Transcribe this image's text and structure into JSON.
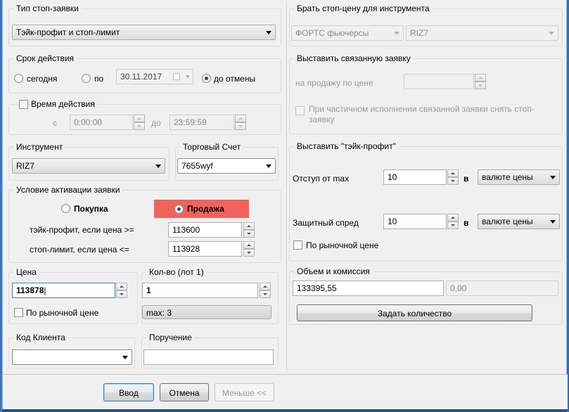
{
  "stop_type": {
    "legend": "Тип стоп-заявки",
    "selected": "Тэйк-профит и стоп-лимит"
  },
  "validity": {
    "legend": "Срок действия",
    "today": "сегодня",
    "until": "по",
    "date_value": "30.11.2017",
    "until_cancel": "до отмены"
  },
  "time": {
    "label": "Время действия",
    "from_label": "с",
    "from_value": "0:00:00",
    "to_label": "до",
    "to_value": "23:59:59"
  },
  "instrument": {
    "legend": "Инструмент",
    "selected": "RIZ7"
  },
  "account": {
    "legend": "Торговый Счет",
    "selected": "7655wyf"
  },
  "activation": {
    "legend": "Условие активации заявки",
    "buy": "Покупка",
    "sell": "Продажа",
    "tp_label": "тэйк-профит, если цена >=",
    "tp_value": "113600",
    "sl_label": "стоп-лимит, если цена <=",
    "sl_value": "113928"
  },
  "price": {
    "legend": "Цена",
    "value": "113878",
    "market_label": "По рыночной цене"
  },
  "quantity": {
    "legend": "Кол-во (лот 1)",
    "value": "1",
    "max": "max: 3"
  },
  "client_code": {
    "legend": "Код Клиента",
    "selected": ""
  },
  "order_note": {
    "legend": "Поручение",
    "value": ""
  },
  "stop_price_source": {
    "legend": "Брать стоп-цену для инструмента",
    "market": "ФОРТС фьючерсы",
    "instrument": "RIZ7"
  },
  "linked_order": {
    "legend": "Выставить связанную заявку",
    "sell_label": "на продажу по цене",
    "cancel_label": "При частичном исполнении связанной заявки снять стоп-заявку"
  },
  "take_profit": {
    "legend": "Выставить \"тэйк-профит\"",
    "offset_label": "Отступ от max",
    "offset_value": "10",
    "in_label": "в",
    "offset_unit": "валюте цены",
    "spread_label": "Защитный спред",
    "spread_value": "10",
    "spread_in_label": "в",
    "spread_unit": "валюте цены",
    "market_label": "По рыночной цене"
  },
  "volume": {
    "legend": "Объем и комиссия",
    "volume_value": "133395,55",
    "commission_value": "0,00",
    "set_qty_button": "Задать количество"
  },
  "footer": {
    "ok": "Ввод",
    "cancel": "Отмена",
    "less": "Меньше <<"
  }
}
